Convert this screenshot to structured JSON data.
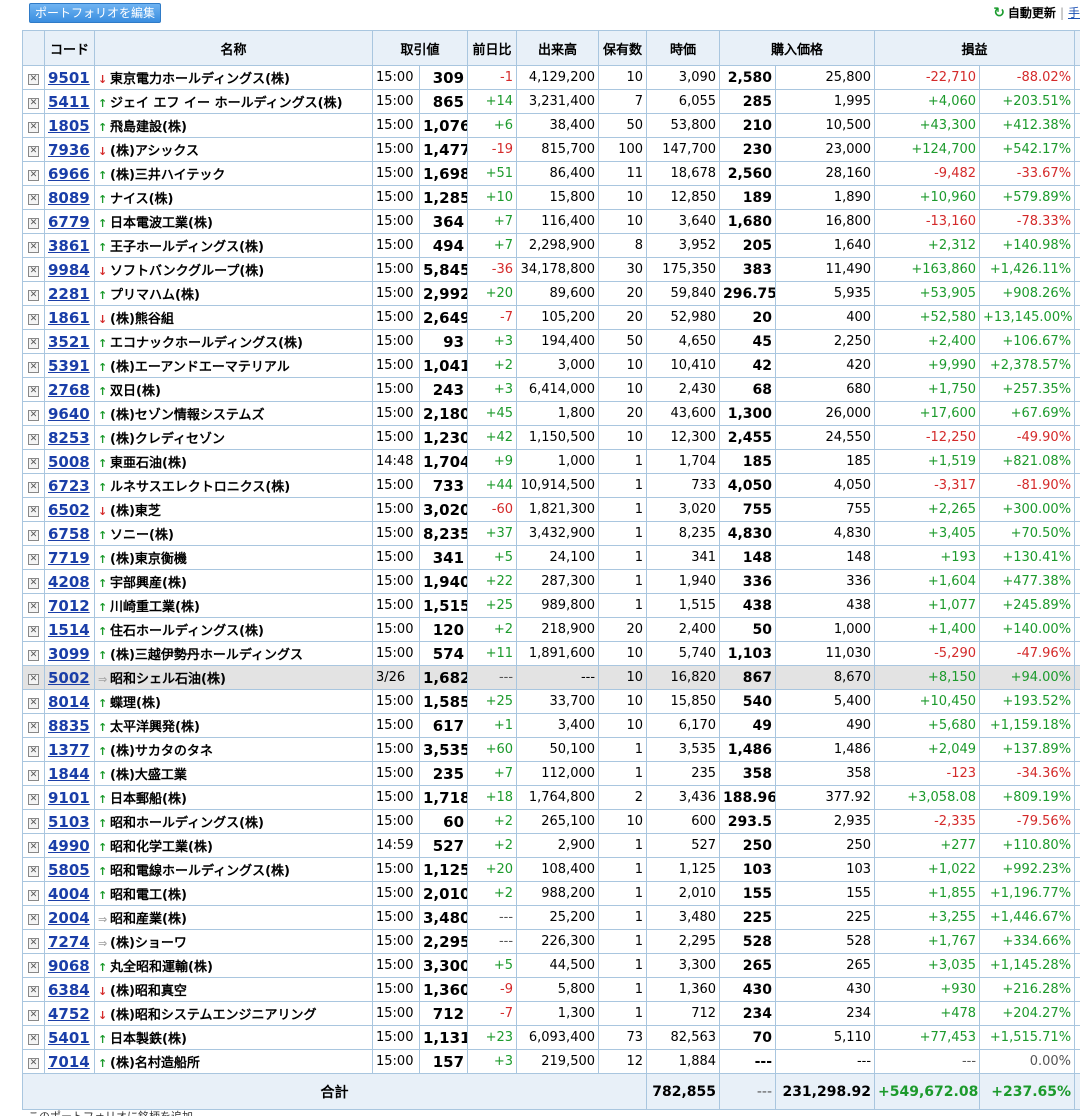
{
  "toolbar": {
    "edit_label": "ポートフォリオを編集",
    "auto_update": "自動更新",
    "manual": "手"
  },
  "headers": [
    "コード",
    "名称",
    "取引値",
    "前日比",
    "出来高",
    "保有数",
    "時価",
    "購入価格",
    "損益"
  ],
  "rows": [
    {
      "code": "9501",
      "name": "東京電力ホールディングス(株)",
      "dir": "dn",
      "time": "15:00",
      "price": "309",
      "chg": "-1",
      "vol": "4,129,200",
      "qty": "10",
      "val": "3,090",
      "bp": "2,580",
      "cost": "25,800",
      "pl": "-22,710",
      "plp": "-88.02%"
    },
    {
      "code": "5411",
      "name": "ジェイ エフ イー ホールディングス(株)",
      "dir": "up",
      "time": "15:00",
      "price": "865",
      "chg": "+14",
      "vol": "3,231,400",
      "qty": "7",
      "val": "6,055",
      "bp": "285",
      "cost": "1,995",
      "pl": "+4,060",
      "plp": "+203.51%"
    },
    {
      "code": "1805",
      "name": "飛島建設(株)",
      "dir": "up",
      "time": "15:00",
      "price": "1,076",
      "chg": "+6",
      "vol": "38,400",
      "qty": "50",
      "val": "53,800",
      "bp": "210",
      "cost": "10,500",
      "pl": "+43,300",
      "plp": "+412.38%"
    },
    {
      "code": "7936",
      "name": "(株)アシックス",
      "dir": "dn",
      "time": "15:00",
      "price": "1,477",
      "chg": "-19",
      "vol": "815,700",
      "qty": "100",
      "val": "147,700",
      "bp": "230",
      "cost": "23,000",
      "pl": "+124,700",
      "plp": "+542.17%"
    },
    {
      "code": "6966",
      "name": "(株)三井ハイテック",
      "dir": "up",
      "time": "15:00",
      "price": "1,698",
      "chg": "+51",
      "vol": "86,400",
      "qty": "11",
      "val": "18,678",
      "bp": "2,560",
      "cost": "28,160",
      "pl": "-9,482",
      "plp": "-33.67%"
    },
    {
      "code": "8089",
      "name": "ナイス(株)",
      "dir": "up",
      "time": "15:00",
      "price": "1,285",
      "chg": "+10",
      "vol": "15,800",
      "qty": "10",
      "val": "12,850",
      "bp": "189",
      "cost": "1,890",
      "pl": "+10,960",
      "plp": "+579.89%"
    },
    {
      "code": "6779",
      "name": "日本電波工業(株)",
      "dir": "up",
      "time": "15:00",
      "price": "364",
      "chg": "+7",
      "vol": "116,400",
      "qty": "10",
      "val": "3,640",
      "bp": "1,680",
      "cost": "16,800",
      "pl": "-13,160",
      "plp": "-78.33%"
    },
    {
      "code": "3861",
      "name": "王子ホールディングス(株)",
      "dir": "up",
      "time": "15:00",
      "price": "494",
      "chg": "+7",
      "vol": "2,298,900",
      "qty": "8",
      "val": "3,952",
      "bp": "205",
      "cost": "1,640",
      "pl": "+2,312",
      "plp": "+140.98%"
    },
    {
      "code": "9984",
      "name": "ソフトバンクグループ(株)",
      "dir": "dn",
      "time": "15:00",
      "price": "5,845",
      "chg": "-36",
      "vol": "34,178,800",
      "qty": "30",
      "val": "175,350",
      "bp": "383",
      "cost": "11,490",
      "pl": "+163,860",
      "plp": "+1,426.11%"
    },
    {
      "code": "2281",
      "name": "プリマハム(株)",
      "dir": "up",
      "time": "15:00",
      "price": "2,992",
      "chg": "+20",
      "vol": "89,600",
      "qty": "20",
      "val": "59,840",
      "bp": "296.75",
      "cost": "5,935",
      "pl": "+53,905",
      "plp": "+908.26%"
    },
    {
      "code": "1861",
      "name": "(株)熊谷組",
      "dir": "dn",
      "time": "15:00",
      "price": "2,649",
      "chg": "-7",
      "vol": "105,200",
      "qty": "20",
      "val": "52,980",
      "bp": "20",
      "cost": "400",
      "pl": "+52,580",
      "plp": "+13,145.00%"
    },
    {
      "code": "3521",
      "name": "エコナックホールディングス(株)",
      "dir": "up",
      "time": "15:00",
      "price": "93",
      "chg": "+3",
      "vol": "194,400",
      "qty": "50",
      "val": "4,650",
      "bp": "45",
      "cost": "2,250",
      "pl": "+2,400",
      "plp": "+106.67%"
    },
    {
      "code": "5391",
      "name": "(株)エーアンドエーマテリアル",
      "dir": "up",
      "time": "15:00",
      "price": "1,041",
      "chg": "+2",
      "vol": "3,000",
      "qty": "10",
      "val": "10,410",
      "bp": "42",
      "cost": "420",
      "pl": "+9,990",
      "plp": "+2,378.57%"
    },
    {
      "code": "2768",
      "name": "双日(株)",
      "dir": "up",
      "time": "15:00",
      "price": "243",
      "chg": "+3",
      "vol": "6,414,000",
      "qty": "10",
      "val": "2,430",
      "bp": "68",
      "cost": "680",
      "pl": "+1,750",
      "plp": "+257.35%"
    },
    {
      "code": "9640",
      "name": "(株)セゾン情報システムズ",
      "dir": "up",
      "time": "15:00",
      "price": "2,180",
      "chg": "+45",
      "vol": "1,800",
      "qty": "20",
      "val": "43,600",
      "bp": "1,300",
      "cost": "26,000",
      "pl": "+17,600",
      "plp": "+67.69%"
    },
    {
      "code": "8253",
      "name": "(株)クレディセゾン",
      "dir": "up",
      "time": "15:00",
      "price": "1,230",
      "chg": "+42",
      "vol": "1,150,500",
      "qty": "10",
      "val": "12,300",
      "bp": "2,455",
      "cost": "24,550",
      "pl": "-12,250",
      "plp": "-49.90%"
    },
    {
      "code": "5008",
      "name": "東亜石油(株)",
      "dir": "up",
      "time": "14:48",
      "price": "1,704",
      "chg": "+9",
      "vol": "1,000",
      "qty": "1",
      "val": "1,704",
      "bp": "185",
      "cost": "185",
      "pl": "+1,519",
      "plp": "+821.08%"
    },
    {
      "code": "6723",
      "name": "ルネサスエレクトロニクス(株)",
      "dir": "up",
      "time": "15:00",
      "price": "733",
      "chg": "+44",
      "vol": "10,914,500",
      "qty": "1",
      "val": "733",
      "bp": "4,050",
      "cost": "4,050",
      "pl": "-3,317",
      "plp": "-81.90%"
    },
    {
      "code": "6502",
      "name": "(株)東芝",
      "dir": "dn",
      "time": "15:00",
      "price": "3,020",
      "chg": "-60",
      "vol": "1,821,300",
      "qty": "1",
      "val": "3,020",
      "bp": "755",
      "cost": "755",
      "pl": "+2,265",
      "plp": "+300.00%"
    },
    {
      "code": "6758",
      "name": "ソニー(株)",
      "dir": "up",
      "time": "15:00",
      "price": "8,235",
      "chg": "+37",
      "vol": "3,432,900",
      "qty": "1",
      "val": "8,235",
      "bp": "4,830",
      "cost": "4,830",
      "pl": "+3,405",
      "plp": "+70.50%"
    },
    {
      "code": "7719",
      "name": "(株)東京衡機",
      "dir": "up",
      "time": "15:00",
      "price": "341",
      "chg": "+5",
      "vol": "24,100",
      "qty": "1",
      "val": "341",
      "bp": "148",
      "cost": "148",
      "pl": "+193",
      "plp": "+130.41%"
    },
    {
      "code": "4208",
      "name": "宇部興産(株)",
      "dir": "up",
      "time": "15:00",
      "price": "1,940",
      "chg": "+22",
      "vol": "287,300",
      "qty": "1",
      "val": "1,940",
      "bp": "336",
      "cost": "336",
      "pl": "+1,604",
      "plp": "+477.38%"
    },
    {
      "code": "7012",
      "name": "川崎重工業(株)",
      "dir": "up",
      "time": "15:00",
      "price": "1,515",
      "chg": "+25",
      "vol": "989,800",
      "qty": "1",
      "val": "1,515",
      "bp": "438",
      "cost": "438",
      "pl": "+1,077",
      "plp": "+245.89%"
    },
    {
      "code": "1514",
      "name": "住石ホールディングス(株)",
      "dir": "up",
      "time": "15:00",
      "price": "120",
      "chg": "+2",
      "vol": "218,900",
      "qty": "20",
      "val": "2,400",
      "bp": "50",
      "cost": "1,000",
      "pl": "+1,400",
      "plp": "+140.00%"
    },
    {
      "code": "3099",
      "name": "(株)三越伊勢丹ホールディングス",
      "dir": "up",
      "time": "15:00",
      "price": "574",
      "chg": "+11",
      "vol": "1,891,600",
      "qty": "10",
      "val": "5,740",
      "bp": "1,103",
      "cost": "11,030",
      "pl": "-5,290",
      "plp": "-47.96%"
    },
    {
      "code": "5002",
      "name": "昭和シェル石油(株)",
      "dir": "fl",
      "time": "3/26",
      "price": "1,682",
      "chg": "---",
      "vol": "---",
      "qty": "10",
      "val": "16,820",
      "bp": "867",
      "cost": "8,670",
      "pl": "+8,150",
      "plp": "+94.00%",
      "halt": true
    },
    {
      "code": "8014",
      "name": "蝶理(株)",
      "dir": "up",
      "time": "15:00",
      "price": "1,585",
      "chg": "+25",
      "vol": "33,700",
      "qty": "10",
      "val": "15,850",
      "bp": "540",
      "cost": "5,400",
      "pl": "+10,450",
      "plp": "+193.52%"
    },
    {
      "code": "8835",
      "name": "太平洋興発(株)",
      "dir": "up",
      "time": "15:00",
      "price": "617",
      "chg": "+1",
      "vol": "3,400",
      "qty": "10",
      "val": "6,170",
      "bp": "49",
      "cost": "490",
      "pl": "+5,680",
      "plp": "+1,159.18%"
    },
    {
      "code": "1377",
      "name": "(株)サカタのタネ",
      "dir": "up",
      "time": "15:00",
      "price": "3,535",
      "chg": "+60",
      "vol": "50,100",
      "qty": "1",
      "val": "3,535",
      "bp": "1,486",
      "cost": "1,486",
      "pl": "+2,049",
      "plp": "+137.89%"
    },
    {
      "code": "1844",
      "name": "(株)大盛工業",
      "dir": "up",
      "time": "15:00",
      "price": "235",
      "chg": "+7",
      "vol": "112,000",
      "qty": "1",
      "val": "235",
      "bp": "358",
      "cost": "358",
      "pl": "-123",
      "plp": "-34.36%"
    },
    {
      "code": "9101",
      "name": "日本郵船(株)",
      "dir": "up",
      "time": "15:00",
      "price": "1,718",
      "chg": "+18",
      "vol": "1,764,800",
      "qty": "2",
      "val": "3,436",
      "bp": "188.96",
      "cost": "377.92",
      "pl": "+3,058.08",
      "plp": "+809.19%"
    },
    {
      "code": "5103",
      "name": "昭和ホールディングス(株)",
      "dir": "up",
      "time": "15:00",
      "price": "60",
      "chg": "+2",
      "vol": "265,100",
      "qty": "10",
      "val": "600",
      "bp": "293.5",
      "cost": "2,935",
      "pl": "-2,335",
      "plp": "-79.56%"
    },
    {
      "code": "4990",
      "name": "昭和化学工業(株)",
      "dir": "up",
      "time": "14:59",
      "price": "527",
      "chg": "+2",
      "vol": "2,900",
      "qty": "1",
      "val": "527",
      "bp": "250",
      "cost": "250",
      "pl": "+277",
      "plp": "+110.80%"
    },
    {
      "code": "5805",
      "name": "昭和電線ホールディングス(株)",
      "dir": "up",
      "time": "15:00",
      "price": "1,125",
      "chg": "+20",
      "vol": "108,400",
      "qty": "1",
      "val": "1,125",
      "bp": "103",
      "cost": "103",
      "pl": "+1,022",
      "plp": "+992.23%"
    },
    {
      "code": "4004",
      "name": "昭和電工(株)",
      "dir": "up",
      "time": "15:00",
      "price": "2,010",
      "chg": "+2",
      "vol": "988,200",
      "qty": "1",
      "val": "2,010",
      "bp": "155",
      "cost": "155",
      "pl": "+1,855",
      "plp": "+1,196.77%"
    },
    {
      "code": "2004",
      "name": "昭和産業(株)",
      "dir": "fl",
      "time": "15:00",
      "price": "3,480",
      "chg": "---",
      "vol": "25,200",
      "qty": "1",
      "val": "3,480",
      "bp": "225",
      "cost": "225",
      "pl": "+3,255",
      "plp": "+1,446.67%"
    },
    {
      "code": "7274",
      "name": "(株)ショーワ",
      "dir": "fl",
      "time": "15:00",
      "price": "2,295",
      "chg": "---",
      "vol": "226,300",
      "qty": "1",
      "val": "2,295",
      "bp": "528",
      "cost": "528",
      "pl": "+1,767",
      "plp": "+334.66%"
    },
    {
      "code": "9068",
      "name": "丸全昭和運輸(株)",
      "dir": "up",
      "time": "15:00",
      "price": "3,300",
      "chg": "+5",
      "vol": "44,500",
      "qty": "1",
      "val": "3,300",
      "bp": "265",
      "cost": "265",
      "pl": "+3,035",
      "plp": "+1,145.28%"
    },
    {
      "code": "6384",
      "name": "(株)昭和真空",
      "dir": "dn",
      "time": "15:00",
      "price": "1,360",
      "chg": "-9",
      "vol": "5,800",
      "qty": "1",
      "val": "1,360",
      "bp": "430",
      "cost": "430",
      "pl": "+930",
      "plp": "+216.28%"
    },
    {
      "code": "4752",
      "name": "(株)昭和システムエンジニアリング",
      "dir": "dn",
      "time": "15:00",
      "price": "712",
      "chg": "-7",
      "vol": "1,300",
      "qty": "1",
      "val": "712",
      "bp": "234",
      "cost": "234",
      "pl": "+478",
      "plp": "+204.27%"
    },
    {
      "code": "5401",
      "name": "日本製鉄(株)",
      "dir": "up",
      "time": "15:00",
      "price": "1,131",
      "chg": "+23",
      "vol": "6,093,400",
      "qty": "73",
      "val": "82,563",
      "bp": "70",
      "cost": "5,110",
      "pl": "+77,453",
      "plp": "+1,515.71%"
    },
    {
      "code": "7014",
      "name": "(株)名村造船所",
      "dir": "up",
      "time": "15:00",
      "price": "157",
      "chg": "+3",
      "vol": "219,500",
      "qty": "12",
      "val": "1,884",
      "bp": "---",
      "cost": "---",
      "pl": "---",
      "plp": "0.00%"
    }
  ],
  "total": {
    "label": "合計",
    "val": "782,855",
    "bp": "---",
    "cost": "231,298.92",
    "pl": "+549,672.08",
    "plp": "+237.65%"
  },
  "footer": {
    "text": "このポートフォリオに銘柄を追加"
  }
}
